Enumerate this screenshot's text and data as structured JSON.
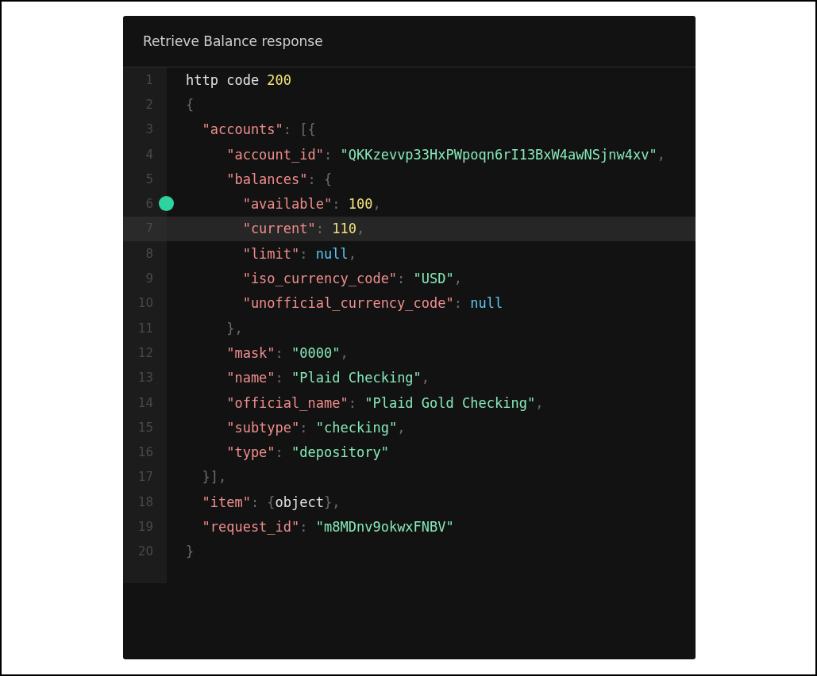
{
  "panel": {
    "title": "Retrieve Balance response"
  },
  "lines": [
    {
      "number": "1",
      "highlighted": false,
      "breakpoint": false,
      "tokens": [
        {
          "kind": "plain",
          "text": "http code "
        },
        {
          "kind": "number",
          "text": "200"
        }
      ]
    },
    {
      "number": "2",
      "highlighted": false,
      "breakpoint": false,
      "tokens": [
        {
          "kind": "punct",
          "text": "{"
        }
      ]
    },
    {
      "number": "3",
      "highlighted": false,
      "breakpoint": false,
      "tokens": [
        {
          "kind": "key",
          "text": "  \"accounts\""
        },
        {
          "kind": "punct",
          "text": ": [{"
        }
      ]
    },
    {
      "number": "4",
      "highlighted": false,
      "breakpoint": false,
      "tokens": [
        {
          "kind": "key",
          "text": "     \"account_id\""
        },
        {
          "kind": "punct",
          "text": ": "
        },
        {
          "kind": "string",
          "text": "\"QKKzevvp33HxPWpoqn6rI13BxW4awNSjnw4xv\""
        },
        {
          "kind": "punct",
          "text": ","
        }
      ]
    },
    {
      "number": "5",
      "highlighted": false,
      "breakpoint": false,
      "tokens": [
        {
          "kind": "key",
          "text": "     \"balances\""
        },
        {
          "kind": "punct",
          "text": ": {"
        }
      ]
    },
    {
      "number": "6",
      "highlighted": false,
      "breakpoint": true,
      "tokens": [
        {
          "kind": "key",
          "text": "       \"available\""
        },
        {
          "kind": "punct",
          "text": ": "
        },
        {
          "kind": "number",
          "text": "100"
        },
        {
          "kind": "punct",
          "text": ","
        }
      ]
    },
    {
      "number": "7",
      "highlighted": true,
      "breakpoint": false,
      "tokens": [
        {
          "kind": "key",
          "text": "       \"current\""
        },
        {
          "kind": "punct",
          "text": ": "
        },
        {
          "kind": "number",
          "text": "110"
        },
        {
          "kind": "punct",
          "text": ","
        }
      ]
    },
    {
      "number": "8",
      "highlighted": false,
      "breakpoint": false,
      "tokens": [
        {
          "kind": "key",
          "text": "       \"limit\""
        },
        {
          "kind": "punct",
          "text": ": "
        },
        {
          "kind": "null",
          "text": "null"
        },
        {
          "kind": "punct",
          "text": ","
        }
      ]
    },
    {
      "number": "9",
      "highlighted": false,
      "breakpoint": false,
      "tokens": [
        {
          "kind": "key",
          "text": "       \"iso_currency_code\""
        },
        {
          "kind": "punct",
          "text": ": "
        },
        {
          "kind": "string",
          "text": "\"USD\""
        },
        {
          "kind": "punct",
          "text": ","
        }
      ]
    },
    {
      "number": "10",
      "highlighted": false,
      "breakpoint": false,
      "tokens": [
        {
          "kind": "key",
          "text": "       \"unofficial_currency_code\""
        },
        {
          "kind": "punct",
          "text": ": "
        },
        {
          "kind": "null",
          "text": "null"
        }
      ]
    },
    {
      "number": "11",
      "highlighted": false,
      "breakpoint": false,
      "tokens": [
        {
          "kind": "punct",
          "text": "     },"
        }
      ]
    },
    {
      "number": "12",
      "highlighted": false,
      "breakpoint": false,
      "tokens": [
        {
          "kind": "key",
          "text": "     \"mask\""
        },
        {
          "kind": "punct",
          "text": ": "
        },
        {
          "kind": "string",
          "text": "\"0000\""
        },
        {
          "kind": "punct",
          "text": ","
        }
      ]
    },
    {
      "number": "13",
      "highlighted": false,
      "breakpoint": false,
      "tokens": [
        {
          "kind": "key",
          "text": "     \"name\""
        },
        {
          "kind": "punct",
          "text": ": "
        },
        {
          "kind": "string",
          "text": "\"Plaid Checking\""
        },
        {
          "kind": "punct",
          "text": ","
        }
      ]
    },
    {
      "number": "14",
      "highlighted": false,
      "breakpoint": false,
      "tokens": [
        {
          "kind": "key",
          "text": "     \"official_name\""
        },
        {
          "kind": "punct",
          "text": ": "
        },
        {
          "kind": "string",
          "text": "\"Plaid Gold Checking\""
        },
        {
          "kind": "punct",
          "text": ","
        }
      ]
    },
    {
      "number": "15",
      "highlighted": false,
      "breakpoint": false,
      "tokens": [
        {
          "kind": "key",
          "text": "     \"subtype\""
        },
        {
          "kind": "punct",
          "text": ": "
        },
        {
          "kind": "string",
          "text": "\"checking\""
        },
        {
          "kind": "punct",
          "text": ","
        }
      ]
    },
    {
      "number": "16",
      "highlighted": false,
      "breakpoint": false,
      "tokens": [
        {
          "kind": "key",
          "text": "     \"type\""
        },
        {
          "kind": "punct",
          "text": ": "
        },
        {
          "kind": "string",
          "text": "\"depository\""
        }
      ]
    },
    {
      "number": "17",
      "highlighted": false,
      "breakpoint": false,
      "tokens": [
        {
          "kind": "punct",
          "text": "  }],"
        }
      ]
    },
    {
      "number": "18",
      "highlighted": false,
      "breakpoint": false,
      "tokens": [
        {
          "kind": "key",
          "text": "  \"item\""
        },
        {
          "kind": "punct",
          "text": ": {"
        },
        {
          "kind": "plain",
          "text": "object"
        },
        {
          "kind": "punct",
          "text": "},"
        }
      ]
    },
    {
      "number": "19",
      "highlighted": false,
      "breakpoint": false,
      "tokens": [
        {
          "kind": "key",
          "text": "  \"request_id\""
        },
        {
          "kind": "punct",
          "text": ": "
        },
        {
          "kind": "string",
          "text": "\"m8MDnv9okwxFNBV\""
        }
      ]
    },
    {
      "number": "20",
      "highlighted": false,
      "breakpoint": false,
      "tokens": [
        {
          "kind": "punct",
          "text": "}"
        }
      ]
    }
  ]
}
